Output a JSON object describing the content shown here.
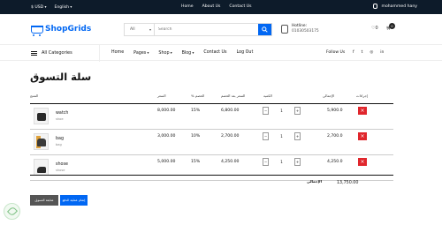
{
  "topbar": {
    "currency": "$ USD",
    "language": "English",
    "links": [
      "Home",
      "About Us",
      "Contact Us"
    ],
    "user": "mohammed hany"
  },
  "header": {
    "logo": "ShopGrids",
    "search_category": "All",
    "search_placeholder": "Search",
    "hotline_label": "Hotline:",
    "hotline_number": "01030503175",
    "wishlist_count": "0",
    "cart_count": "0"
  },
  "nav": {
    "all_categories": "All Categories",
    "items": [
      "Home",
      "Pages",
      "Shop",
      "Blog",
      "Contact Us",
      "Log Out"
    ],
    "follow_us": "Follow Us",
    "social": [
      "f",
      "t",
      "◎",
      "in"
    ]
  },
  "page_title": "سلة التسوق",
  "table": {
    "headers": {
      "product": "المنتج",
      "price": "السعر",
      "discount": "% الخصم",
      "price_after_discount": "السعر بعد الخصم",
      "quantity": "الكمية",
      "subtotal": "الإجمالي",
      "actions": "إجراءات"
    },
    "rows": [
      {
        "name": "watch",
        "category": "shoe",
        "price": "8,000.00",
        "discount": "15%",
        "after": "6,800.00",
        "qty": "1",
        "total": "5,900.0"
      },
      {
        "name": "bag",
        "category": "bag",
        "price": "3,000.00",
        "discount": "10%",
        "after": "2,700.00",
        "qty": "1",
        "total": "2,700.0"
      },
      {
        "name": "shose",
        "category": "shose",
        "price": "5,000.00",
        "discount": "15%",
        "after": "4,250.00",
        "qty": "1",
        "total": "4,250.0"
      }
    ],
    "total_label": "الإجمالي",
    "total_value": "13,750.00"
  },
  "buttons": {
    "continue_shopping": "متابعة التسوق",
    "checkout": "إتمام عملية الدفع"
  }
}
